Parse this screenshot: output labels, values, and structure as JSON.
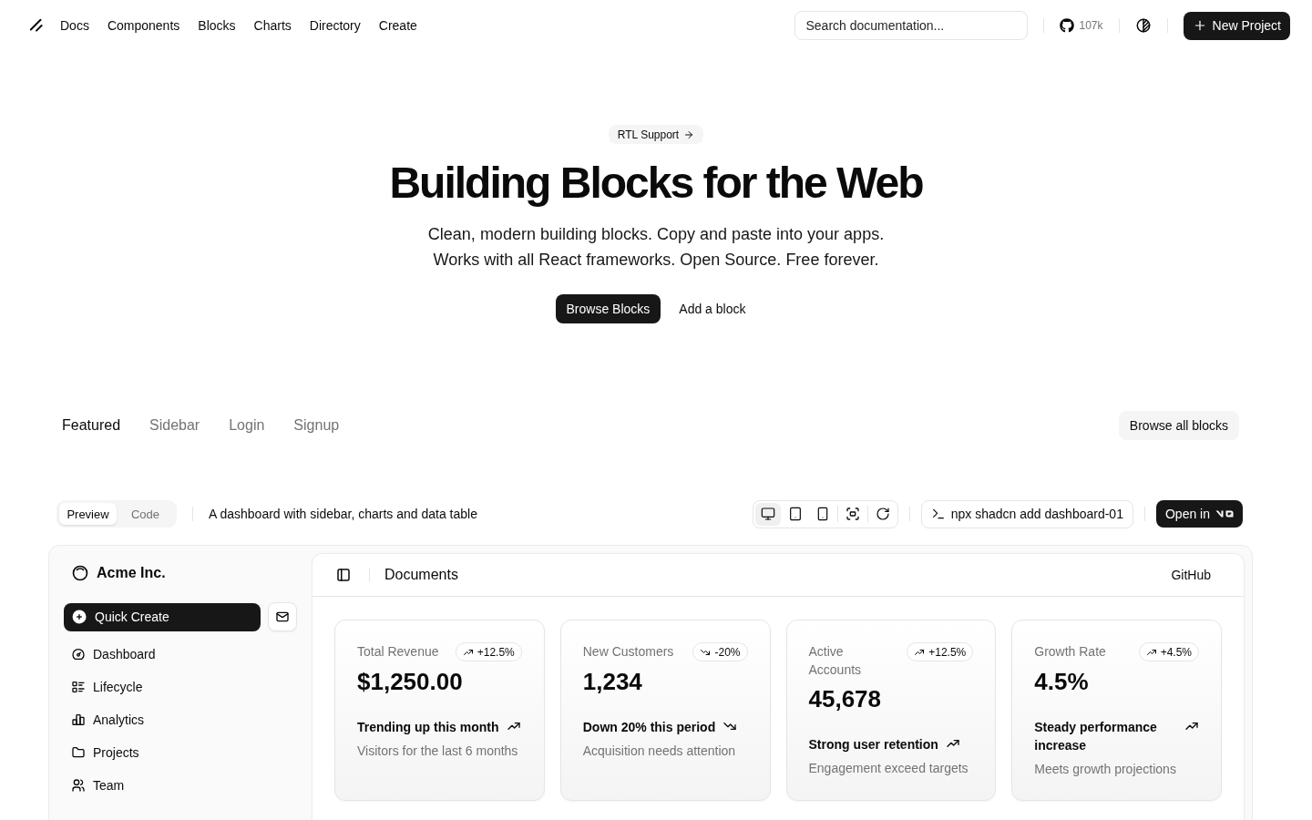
{
  "header": {
    "nav": [
      "Docs",
      "Components",
      "Blocks",
      "Charts",
      "Directory",
      "Create"
    ],
    "search": {
      "placeholder": "Search documentation..."
    },
    "github_stars": "107k",
    "new_project": "New Project"
  },
  "hero": {
    "badge": "RTL Support",
    "title": "Building Blocks for the Web",
    "description_lines": [
      "Clean, modern building blocks. Copy and paste into your apps.",
      "Works with all React frameworks. Open Source. Free forever."
    ],
    "actions": [
      {
        "label": "Browse Blocks",
        "kind": "primary"
      },
      {
        "label": "Add a block",
        "kind": "ghost"
      }
    ]
  },
  "block_tabs": {
    "tabs": [
      {
        "label": "Featured",
        "selected": true
      },
      {
        "label": "Sidebar",
        "selected": false
      },
      {
        "label": "Login",
        "selected": false
      },
      {
        "label": "Signup",
        "selected": false
      }
    ],
    "browse_all": "Browse all blocks"
  },
  "block_toolbar": {
    "view_modes": [
      {
        "label": "Preview",
        "selected": true
      },
      {
        "label": "Code",
        "selected": false
      }
    ],
    "description": "A dashboard with sidebar, charts and data table",
    "viewports": [
      {
        "selected": true
      },
      {
        "selected": false
      },
      {
        "selected": false
      }
    ],
    "command": "npx shadcn add dashboard-01",
    "open_in": "Open in"
  },
  "preview": {
    "sidebar": {
      "company": "Acme Inc.",
      "quick_create": "Quick Create",
      "items": [
        {
          "label": "Dashboard"
        },
        {
          "label": "Lifecycle"
        },
        {
          "label": "Analytics"
        },
        {
          "label": "Projects"
        },
        {
          "label": "Team"
        }
      ]
    },
    "main": {
      "title": "Documents",
      "github_link": "GitHub",
      "cards": [
        {
          "label": "Total Revenue",
          "change": "+12.5%",
          "change_up": true,
          "value": "$1,250.00",
          "footer": "Trending up this month",
          "footer_up": true,
          "note": "Visitors for the last 6 months"
        },
        {
          "label": "New Customers",
          "change": "-20%",
          "change_up": false,
          "value": "1,234",
          "footer": "Down 20% this period",
          "footer_up": false,
          "note": "Acquisition needs attention"
        },
        {
          "label": "Active Accounts",
          "change": "+12.5%",
          "change_up": true,
          "value": "45,678",
          "footer": "Strong user retention",
          "footer_up": true,
          "note": "Engagement exceed targets"
        },
        {
          "label": "Growth Rate",
          "change": "+4.5%",
          "change_up": true,
          "value": "4.5%",
          "footer": "Steady performance increase",
          "footer_up": true,
          "note": "Meets growth projections"
        }
      ]
    }
  }
}
